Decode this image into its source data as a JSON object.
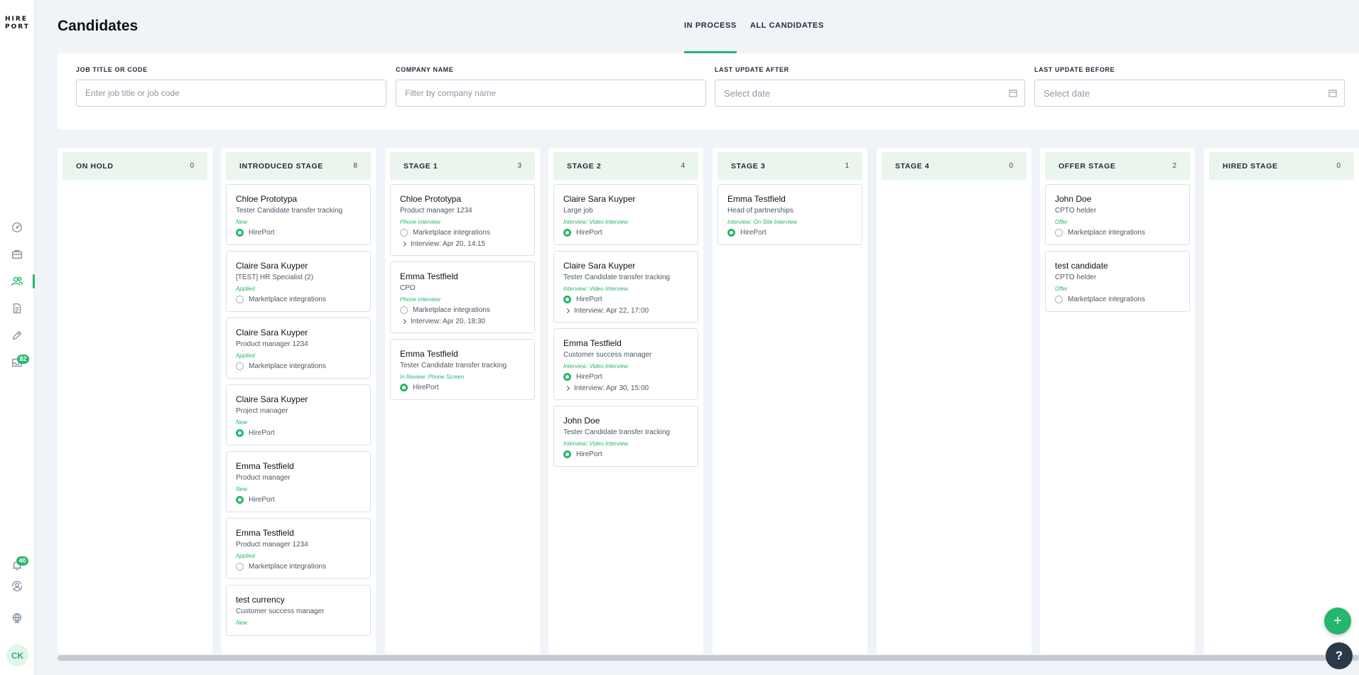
{
  "app": {
    "logo_text": "HIRE PORT",
    "avatar_initials": "CK"
  },
  "badges": {
    "messages": "82",
    "notifications": "40"
  },
  "page": {
    "title": "Candidates"
  },
  "tabs": [
    {
      "label": "IN PROCESS"
    },
    {
      "label": "ALL CANDIDATES"
    }
  ],
  "filters": {
    "job": {
      "label": "JOB TITLE OR CODE",
      "placeholder": "Enter job title or job code"
    },
    "company": {
      "label": "COMPANY NAME",
      "placeholder": "Filter by company name"
    },
    "after": {
      "label": "LAST UPDATE AFTER",
      "placeholder": "Select date"
    },
    "before": {
      "label": "LAST UPDATE BEFORE",
      "placeholder": "Select date"
    }
  },
  "columns": [
    {
      "title": "ON HOLD",
      "count": "0",
      "cards": []
    },
    {
      "title": "INTRODUCED STAGE",
      "count": "8",
      "cards": [
        {
          "name": "Chloe Prototypa",
          "job": "Tester Candidate transfer tracking",
          "status": "New",
          "company": "HirePort",
          "company_icon": "hp"
        },
        {
          "name": "Claire Sara Kuyper",
          "job": "[TEST] HR Specialist (2)",
          "status": "Applied",
          "company": "Marketplace integrations",
          "company_icon": "mp"
        },
        {
          "name": "Claire Sara Kuyper",
          "job": "Product manager 1234",
          "status": "Applied",
          "company": "Marketplace integrations",
          "company_icon": "mp"
        },
        {
          "name": "Claire Sara Kuyper",
          "job": "Project manager",
          "status": "New",
          "company": "HirePort",
          "company_icon": "hp"
        },
        {
          "name": "Emma Testfield",
          "job": "Product manager",
          "status": "New",
          "company": "HirePort",
          "company_icon": "hp"
        },
        {
          "name": "Emma Testfield",
          "job": "Product manager 1234",
          "status": "Applied",
          "company": "Marketplace integrations",
          "company_icon": "mp"
        },
        {
          "name": "test currency",
          "job": "Customer success manager",
          "status": "New",
          "company": "",
          "company_icon": ""
        }
      ]
    },
    {
      "title": "STAGE 1",
      "count": "3",
      "cards": [
        {
          "name": "Chloe Prototypa",
          "job": "Product manager 1234",
          "status": "Phone interview",
          "company": "Marketplace integrations",
          "company_icon": "mp",
          "interview": "Interview: Apr 20, 14:15"
        },
        {
          "name": "Emma Testfield",
          "job": "CPO",
          "status": "Phone interview",
          "company": "Marketplace integrations",
          "company_icon": "mp",
          "interview": "Interview: Apr 20, 18:30"
        },
        {
          "name": "Emma Testfield",
          "job": "Tester Candidate transfer tracking",
          "status": "In Review: Phone Screen",
          "company": "HirePort",
          "company_icon": "hp"
        }
      ]
    },
    {
      "title": "STAGE 2",
      "count": "4",
      "cards": [
        {
          "name": "Claire Sara Kuyper",
          "job": "Large job",
          "status": "Interview: Video Interview",
          "company": "HirePort",
          "company_icon": "hp"
        },
        {
          "name": "Claire Sara Kuyper",
          "job": "Tester Candidate transfer tracking",
          "status": "Interview: Video Interview",
          "company": "HirePort",
          "company_icon": "hp",
          "interview": "Interview: Apr 22, 17:00"
        },
        {
          "name": "Emma Testfield",
          "job": "Customer success manager",
          "status": "Interview: Video Interview",
          "company": "HirePort",
          "company_icon": "hp",
          "interview": "Interview: Apr 30, 15:00"
        },
        {
          "name": "John Doe",
          "job": "Tester Candidate transfer tracking",
          "status": "Interview: Video Interview",
          "company": "HirePort",
          "company_icon": "hp"
        }
      ]
    },
    {
      "title": "STAGE 3",
      "count": "1",
      "cards": [
        {
          "name": "Emma Testfield",
          "job": "Head of partnerships",
          "status": "Interview: On-Site Interview",
          "company": "HirePort",
          "company_icon": "hp"
        }
      ]
    },
    {
      "title": "STAGE 4",
      "count": "0",
      "cards": []
    },
    {
      "title": "OFFER STAGE",
      "count": "2",
      "cards": [
        {
          "name": "John Doe",
          "job": "CPTO helder",
          "status": "Offer",
          "company": "Marketplace integrations",
          "company_icon": "mp"
        },
        {
          "name": "test candidate",
          "job": "CPTO helder",
          "status": "Offer",
          "company": "Marketplace integrations",
          "company_icon": "mp"
        }
      ]
    },
    {
      "title": "HIRED STAGE",
      "count": "0",
      "cards": []
    }
  ],
  "colors": {
    "accent": "#27b66e",
    "background": "#f0f4f8",
    "column_header": "#eaf5ee"
  },
  "icons": [
    "dashboard-icon",
    "briefcase-icon",
    "candidates-icon",
    "documents-icon",
    "pencil-icon",
    "inbox-icon",
    "bell-icon",
    "refresh-user-icon",
    "globe-icon",
    "plus-icon",
    "help-icon",
    "calendar-icon"
  ]
}
